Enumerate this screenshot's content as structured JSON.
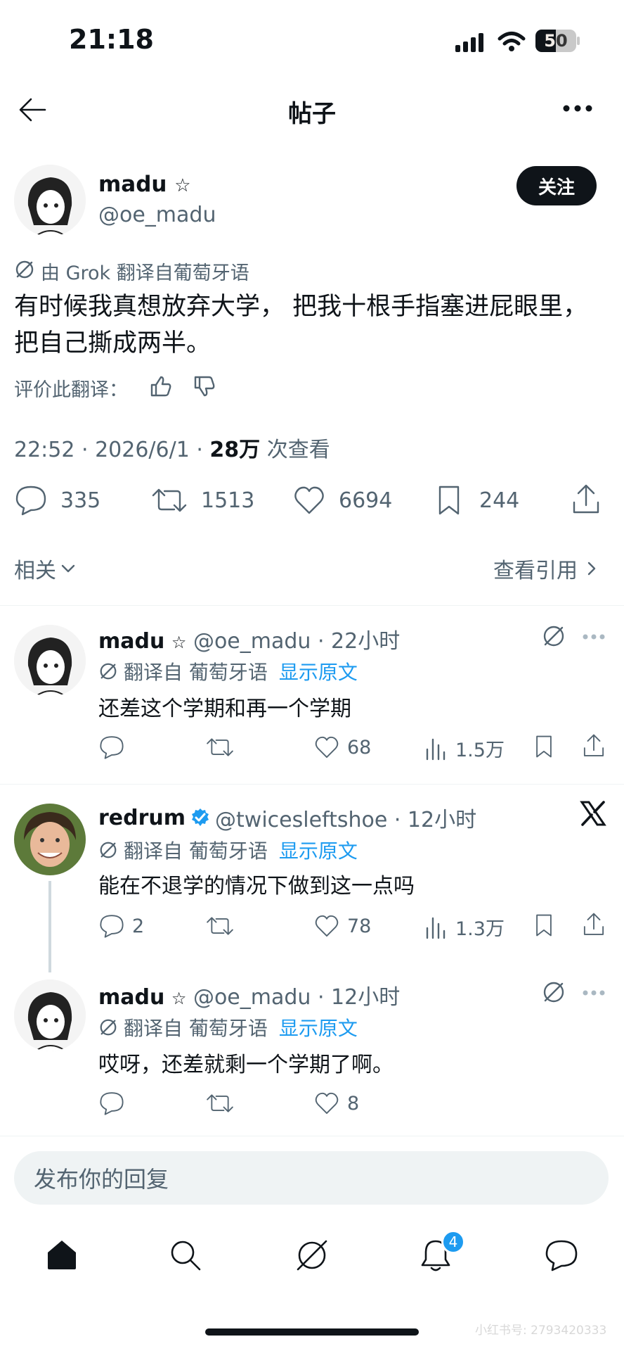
{
  "status_bar": {
    "time": "21:18",
    "battery": "50"
  },
  "header": {
    "title": "帖子"
  },
  "main_post": {
    "name": "madu",
    "name_badge": "☆",
    "handle": "@oe_madu",
    "follow_label": "关注",
    "translated_note": "由 Grok 翻译自葡萄牙语",
    "text": "有时候我真想放弃大学，  把我十根手指塞进屁眼里，把自己撕成两半。",
    "rate_label": "评价此翻译：",
    "time_date": "22:52 · 2026/6/1 · ",
    "views_num": "28万",
    "views_label": " 次查看",
    "stats": {
      "replies": "335",
      "reposts": "1513",
      "likes": "6694",
      "bookmarks": "244"
    }
  },
  "related": {
    "label": "相关",
    "quotes_label": "查看引用"
  },
  "replies": [
    {
      "name": "madu",
      "badge": "☆",
      "handle_time": "@oe_madu · 22小时",
      "translated": "翻译自 葡萄牙语",
      "show_original": "显示原文",
      "text": "还差这个学期和再一个学期",
      "replies": "",
      "reposts": "",
      "likes": "68",
      "views": "1.5万"
    },
    {
      "name": "redrum",
      "badge": "",
      "handle_time": "@twicesleftshoe · 12小时",
      "translated": "翻译自 葡萄牙语",
      "show_original": "显示原文",
      "text": "能在不退学的情况下做到这一点吗",
      "replies": "2",
      "reposts": "",
      "likes": "78",
      "views": "1.3万"
    },
    {
      "name": "madu",
      "badge": "☆",
      "handle_time": "@oe_madu · 12小时",
      "translated": "翻译自 葡萄牙语",
      "show_original": "显示原文",
      "text": "哎呀，还差就剩一个学期了啊。",
      "replies": "",
      "reposts": "",
      "likes": "8",
      "views": ""
    }
  ],
  "reply_input": {
    "placeholder": "发布你的回复"
  },
  "bottom_nav": {
    "notification_count": "4"
  },
  "watermark": "小红书号: 2793420333",
  "colors": {
    "accent": "#1d9bf0",
    "text": "#0f1419",
    "muted": "#536471",
    "divider": "#eff3f4"
  }
}
